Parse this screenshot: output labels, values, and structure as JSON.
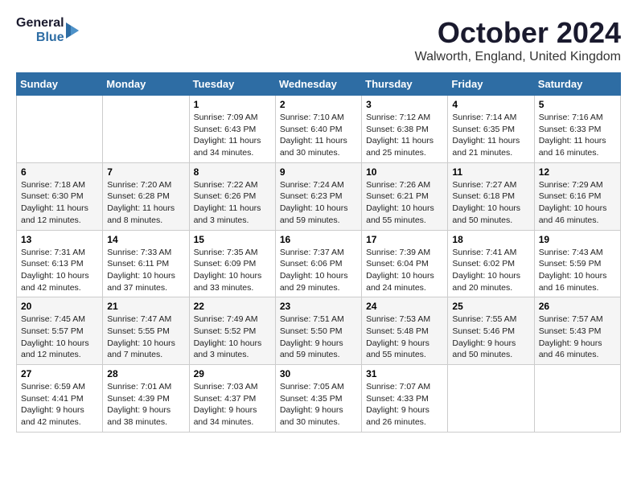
{
  "header": {
    "logo_line1": "General",
    "logo_line2": "Blue",
    "title": "October 2024",
    "location": "Walworth, England, United Kingdom"
  },
  "weekdays": [
    "Sunday",
    "Monday",
    "Tuesday",
    "Wednesday",
    "Thursday",
    "Friday",
    "Saturday"
  ],
  "weeks": [
    [
      {
        "day": "",
        "info": ""
      },
      {
        "day": "",
        "info": ""
      },
      {
        "day": "1",
        "info": "Sunrise: 7:09 AM\nSunset: 6:43 PM\nDaylight: 11 hours\nand 34 minutes."
      },
      {
        "day": "2",
        "info": "Sunrise: 7:10 AM\nSunset: 6:40 PM\nDaylight: 11 hours\nand 30 minutes."
      },
      {
        "day": "3",
        "info": "Sunrise: 7:12 AM\nSunset: 6:38 PM\nDaylight: 11 hours\nand 25 minutes."
      },
      {
        "day": "4",
        "info": "Sunrise: 7:14 AM\nSunset: 6:35 PM\nDaylight: 11 hours\nand 21 minutes."
      },
      {
        "day": "5",
        "info": "Sunrise: 7:16 AM\nSunset: 6:33 PM\nDaylight: 11 hours\nand 16 minutes."
      }
    ],
    [
      {
        "day": "6",
        "info": "Sunrise: 7:18 AM\nSunset: 6:30 PM\nDaylight: 11 hours\nand 12 minutes."
      },
      {
        "day": "7",
        "info": "Sunrise: 7:20 AM\nSunset: 6:28 PM\nDaylight: 11 hours\nand 8 minutes."
      },
      {
        "day": "8",
        "info": "Sunrise: 7:22 AM\nSunset: 6:26 PM\nDaylight: 11 hours\nand 3 minutes."
      },
      {
        "day": "9",
        "info": "Sunrise: 7:24 AM\nSunset: 6:23 PM\nDaylight: 10 hours\nand 59 minutes."
      },
      {
        "day": "10",
        "info": "Sunrise: 7:26 AM\nSunset: 6:21 PM\nDaylight: 10 hours\nand 55 minutes."
      },
      {
        "day": "11",
        "info": "Sunrise: 7:27 AM\nSunset: 6:18 PM\nDaylight: 10 hours\nand 50 minutes."
      },
      {
        "day": "12",
        "info": "Sunrise: 7:29 AM\nSunset: 6:16 PM\nDaylight: 10 hours\nand 46 minutes."
      }
    ],
    [
      {
        "day": "13",
        "info": "Sunrise: 7:31 AM\nSunset: 6:13 PM\nDaylight: 10 hours\nand 42 minutes."
      },
      {
        "day": "14",
        "info": "Sunrise: 7:33 AM\nSunset: 6:11 PM\nDaylight: 10 hours\nand 37 minutes."
      },
      {
        "day": "15",
        "info": "Sunrise: 7:35 AM\nSunset: 6:09 PM\nDaylight: 10 hours\nand 33 minutes."
      },
      {
        "day": "16",
        "info": "Sunrise: 7:37 AM\nSunset: 6:06 PM\nDaylight: 10 hours\nand 29 minutes."
      },
      {
        "day": "17",
        "info": "Sunrise: 7:39 AM\nSunset: 6:04 PM\nDaylight: 10 hours\nand 24 minutes."
      },
      {
        "day": "18",
        "info": "Sunrise: 7:41 AM\nSunset: 6:02 PM\nDaylight: 10 hours\nand 20 minutes."
      },
      {
        "day": "19",
        "info": "Sunrise: 7:43 AM\nSunset: 5:59 PM\nDaylight: 10 hours\nand 16 minutes."
      }
    ],
    [
      {
        "day": "20",
        "info": "Sunrise: 7:45 AM\nSunset: 5:57 PM\nDaylight: 10 hours\nand 12 minutes."
      },
      {
        "day": "21",
        "info": "Sunrise: 7:47 AM\nSunset: 5:55 PM\nDaylight: 10 hours\nand 7 minutes."
      },
      {
        "day": "22",
        "info": "Sunrise: 7:49 AM\nSunset: 5:52 PM\nDaylight: 10 hours\nand 3 minutes."
      },
      {
        "day": "23",
        "info": "Sunrise: 7:51 AM\nSunset: 5:50 PM\nDaylight: 9 hours\nand 59 minutes."
      },
      {
        "day": "24",
        "info": "Sunrise: 7:53 AM\nSunset: 5:48 PM\nDaylight: 9 hours\nand 55 minutes."
      },
      {
        "day": "25",
        "info": "Sunrise: 7:55 AM\nSunset: 5:46 PM\nDaylight: 9 hours\nand 50 minutes."
      },
      {
        "day": "26",
        "info": "Sunrise: 7:57 AM\nSunset: 5:43 PM\nDaylight: 9 hours\nand 46 minutes."
      }
    ],
    [
      {
        "day": "27",
        "info": "Sunrise: 6:59 AM\nSunset: 4:41 PM\nDaylight: 9 hours\nand 42 minutes."
      },
      {
        "day": "28",
        "info": "Sunrise: 7:01 AM\nSunset: 4:39 PM\nDaylight: 9 hours\nand 38 minutes."
      },
      {
        "day": "29",
        "info": "Sunrise: 7:03 AM\nSunset: 4:37 PM\nDaylight: 9 hours\nand 34 minutes."
      },
      {
        "day": "30",
        "info": "Sunrise: 7:05 AM\nSunset: 4:35 PM\nDaylight: 9 hours\nand 30 minutes."
      },
      {
        "day": "31",
        "info": "Sunrise: 7:07 AM\nSunset: 4:33 PM\nDaylight: 9 hours\nand 26 minutes."
      },
      {
        "day": "",
        "info": ""
      },
      {
        "day": "",
        "info": ""
      }
    ]
  ]
}
